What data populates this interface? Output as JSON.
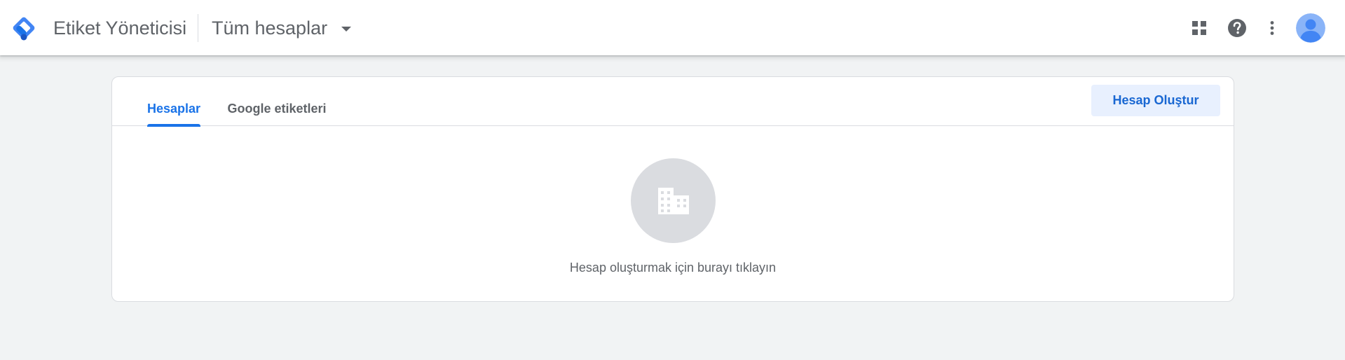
{
  "header": {
    "product_name": "Etiket Yöneticisi",
    "account_picker_label": "Tüm hesaplar",
    "icons": {
      "logo": "tag-manager-logo-icon",
      "apps": "apps-grid-icon",
      "help": "help-icon",
      "more": "more-vert-icon",
      "avatar": "account-avatar-icon"
    }
  },
  "tabs": [
    {
      "label": "Hesaplar",
      "active": true
    },
    {
      "label": "Google etiketleri",
      "active": false
    }
  ],
  "actions": {
    "create_account_label": "Hesap Oluştur"
  },
  "empty_state": {
    "icon": "building-icon",
    "message": "Hesap oluşturmak için burayı tıklayın"
  },
  "colors": {
    "accent": "#1a73e8",
    "page_background": "#f1f3f4",
    "create_button_bg": "#e8f0fe",
    "create_button_text": "#1967d2",
    "empty_circle": "#dadce0",
    "avatar_bg": "#8ab4f8",
    "avatar_fg": "#4285f4"
  }
}
